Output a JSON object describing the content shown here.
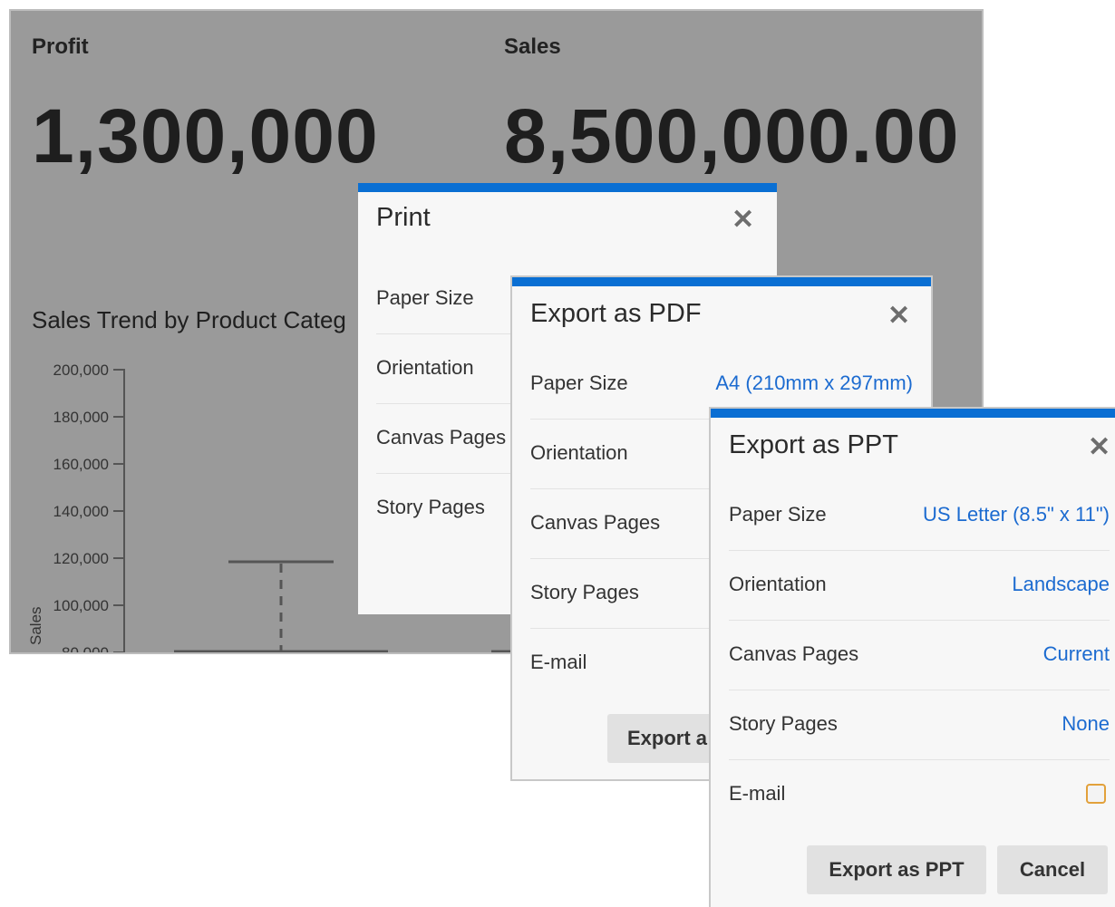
{
  "dashboard": {
    "profit_label": "Profit",
    "profit_value": "1,300,000",
    "sales_label": "Sales",
    "sales_value": "8,500,000.00",
    "chart_title": "Sales Trend by Product Categ",
    "y_axis_label": "Sales",
    "y_ticks": [
      "200,000",
      "180,000",
      "160,000",
      "140,000",
      "120,000",
      "100,000",
      "80,000"
    ]
  },
  "print_dialog": {
    "title": "Print",
    "rows": [
      {
        "label": "Paper Size"
      },
      {
        "label": "Orientation"
      },
      {
        "label": "Canvas Pages"
      },
      {
        "label": "Story Pages"
      }
    ]
  },
  "pdf_dialog": {
    "title": "Export as PDF",
    "rows": [
      {
        "label": "Paper Size",
        "value": "A4 (210mm x 297mm)"
      },
      {
        "label": "Orientation"
      },
      {
        "label": "Canvas Pages"
      },
      {
        "label": "Story Pages"
      },
      {
        "label": "E-mail"
      }
    ],
    "export_button": "Export a"
  },
  "ppt_dialog": {
    "title": "Export as PPT",
    "rows": [
      {
        "label": "Paper Size",
        "value": "US Letter (8.5\" x 11\")"
      },
      {
        "label": "Orientation",
        "value": "Landscape"
      },
      {
        "label": "Canvas Pages",
        "value": "Current"
      },
      {
        "label": "Story Pages",
        "value": "None"
      },
      {
        "label": "E-mail"
      }
    ],
    "export_button": "Export as PPT",
    "cancel_button": "Cancel"
  },
  "colors": {
    "accent_bar": "#0a6fd3",
    "link_value": "#1c6bd0",
    "checkbox_border": "#e2a13b"
  },
  "icons": {
    "close": "close-icon"
  }
}
